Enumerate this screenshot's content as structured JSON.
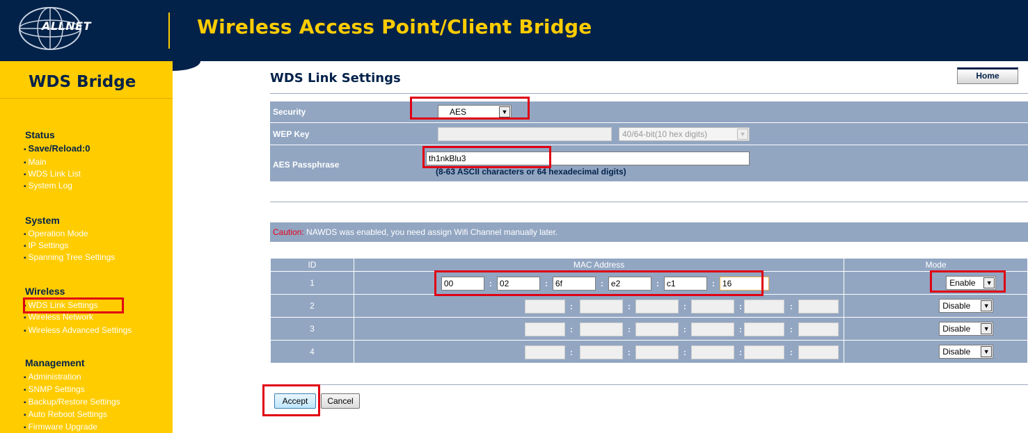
{
  "header": {
    "brand": "ALLNET",
    "title": "Wireless Access Point/Client Bridge"
  },
  "sidebar": {
    "title": "WDS Bridge",
    "sections": [
      {
        "label": "Status",
        "items": [
          "Save/Reload:0",
          "Main",
          "WDS Link List",
          "System Log"
        ]
      },
      {
        "label": "System",
        "items": [
          "Operation Mode",
          "IP Settings",
          "Spanning Tree Settings"
        ]
      },
      {
        "label": "Wireless",
        "items": [
          "WDS Link Settings",
          "Wireless Network",
          "Wireless Advanced Settings"
        ]
      },
      {
        "label": "Management",
        "items": [
          "Administration",
          "SNMP Settings",
          "Backup/Restore Settings",
          "Auto Reboot Settings",
          "Firmware Upgrade"
        ]
      }
    ]
  },
  "page": {
    "title": "WDS Link Settings",
    "home_label": "Home"
  },
  "security": {
    "label": "Security",
    "value": "AES"
  },
  "wep": {
    "label": "WEP Key",
    "value": "",
    "length_option": "40/64-bit(10 hex digits)"
  },
  "aes": {
    "label": "AES Passphrase",
    "value": "th1nkBlu3",
    "hint": "(8-63 ASCII characters or 64 hexadecimal digits)"
  },
  "caution": {
    "prefix": "Caution:",
    "message": "NAWDS was enabled, you need assign Wifi Channel manually later."
  },
  "table": {
    "headers": [
      "ID",
      "MAC Address",
      "Mode"
    ],
    "rows": [
      {
        "id": "1",
        "mac": [
          "00",
          "02",
          "6f",
          "e2",
          "c1",
          "16"
        ],
        "mode": "Enable",
        "enabled": true
      },
      {
        "id": "2",
        "mac": [
          "",
          "",
          "",
          "",
          "",
          ""
        ],
        "mode": "Disable",
        "enabled": false
      },
      {
        "id": "3",
        "mac": [
          "",
          "",
          "",
          "",
          "",
          ""
        ],
        "mode": "Disable",
        "enabled": false
      },
      {
        "id": "4",
        "mac": [
          "",
          "",
          "",
          "",
          "",
          ""
        ],
        "mode": "Disable",
        "enabled": false
      }
    ]
  },
  "buttons": {
    "accept": "Accept",
    "cancel": "Cancel"
  },
  "colors": {
    "navy": "#03224a",
    "accent_yellow": "#ffcc00",
    "panel_blue": "#92a6c2",
    "highlight_red": "#e00012",
    "caution_red": "#e8001c"
  }
}
